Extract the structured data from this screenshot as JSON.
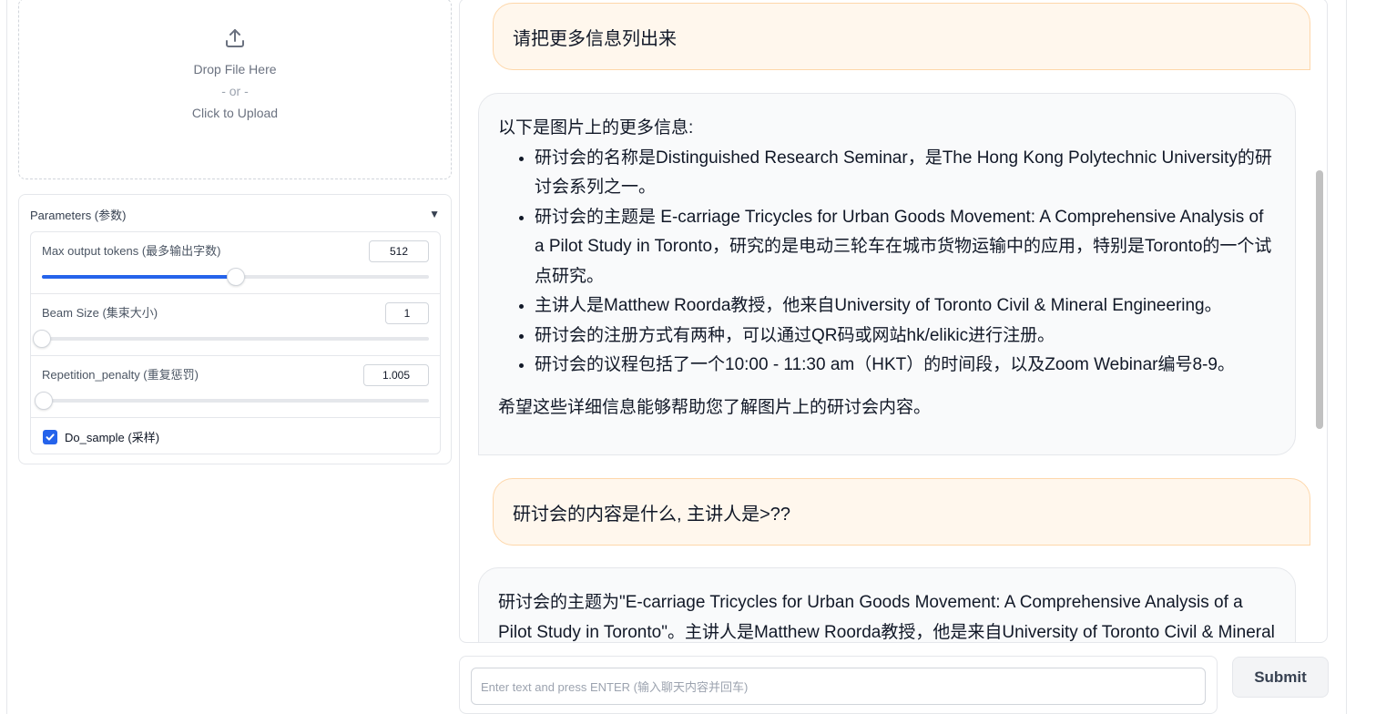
{
  "upload": {
    "drop_text": "Drop File Here",
    "or_text": "- or -",
    "click_text": "Click to Upload"
  },
  "params": {
    "title": "Parameters (参数)",
    "caret": "▼",
    "max_tokens": {
      "label": "Max output tokens (最多输出字数)",
      "value": "512",
      "fraction": 0.5
    },
    "beam_size": {
      "label": "Beam Size (集束大小)",
      "value": "1",
      "fraction": 0.0
    },
    "repetition_penalty": {
      "label": "Repetition_penalty (重复惩罚)",
      "value": "1.005",
      "fraction": 0.005
    },
    "do_sample": {
      "label": "Do_sample (采样)",
      "checked": true
    }
  },
  "chat": {
    "user_1": "请把更多信息列出来",
    "bot_1": {
      "intro": "以下是图片上的更多信息:",
      "items": [
        "研讨会的名称是Distinguished Research Seminar，是The Hong Kong Polytechnic University的研讨会系列之一。",
        "研讨会的主题是 E-carriage Tricycles for Urban Goods Movement: A Comprehensive Analysis of a Pilot Study in Toronto，研究的是电动三轮车在城市货物运输中的应用，特别是Toronto的一个试点研究。",
        "主讲人是Matthew Roorda教授，他来自University of Toronto Civil & Mineral Engineering。",
        "研讨会的注册方式有两种，可以通过QR码或网站hk/elikic进行注册。",
        "研讨会的议程包括了一个10:00 - 11:30 am（HKT）的时间段，以及Zoom Webinar编号8-9。"
      ],
      "closing": "希望这些详细信息能够帮助您了解图片上的研讨会内容。"
    },
    "user_2": "研讨会的内容是什么, 主讲人是>??",
    "bot_2": "研讨会的主题为\"E-carriage Tricycles for Urban Goods Movement: A Comprehensive Analysis of a Pilot Study in Toronto\"。主讲人是Matthew Roorda教授，他是来自University of Toronto Civil & Mineral"
  },
  "input": {
    "placeholder": "Enter text and press ENTER (输入聊天内容并回车)",
    "value": ""
  },
  "submit_label": "Submit",
  "colors": {
    "accent": "#2563eb",
    "user_bubble": "#fff7ed",
    "user_border": "#fed7aa",
    "bot_bubble": "#f9fafb"
  }
}
